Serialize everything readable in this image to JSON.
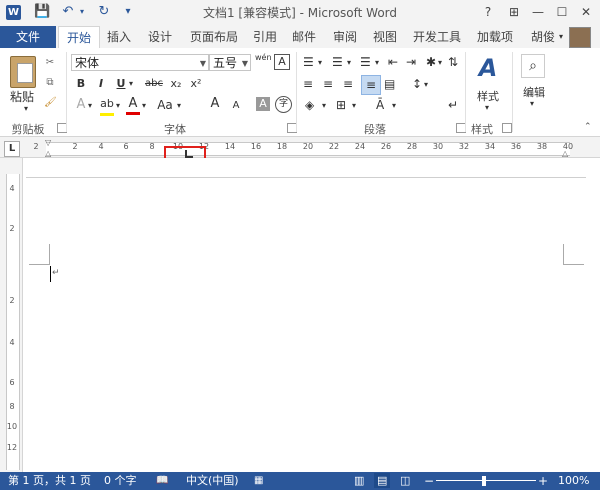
{
  "window": {
    "title": "文档1 [兼容模式] - Microsoft Word",
    "logo": "W",
    "controls": [
      "?",
      "⊞",
      "—",
      "☐",
      "✕"
    ]
  },
  "qat": [
    "save-icon",
    "undo-icon",
    "redo-icon",
    "customize-icon"
  ],
  "tabs": {
    "file": "文件",
    "items": [
      "开始",
      "插入",
      "设计",
      "页面布局",
      "引用",
      "邮件",
      "审阅",
      "视图",
      "开发工具",
      "加载项"
    ],
    "user": "胡俊"
  },
  "ribbon": {
    "clipboard": {
      "paste": "粘贴",
      "label": "剪贴板"
    },
    "font": {
      "font_name": "宋体",
      "font_size": "五号",
      "wen": "wén",
      "buttons": [
        "B",
        "I",
        "U",
        "abc",
        "x₂",
        "x²",
        "Aa",
        "A",
        "A"
      ],
      "grow": "A",
      "shrink": "A",
      "label": "字体"
    },
    "paragraph": {
      "label": "段落"
    },
    "styles": {
      "button": "样式",
      "label": "样式"
    },
    "editing": {
      "button": "编辑"
    }
  },
  "ruler": {
    "numbers": [
      "2",
      "2",
      "4",
      "6",
      "8",
      "10",
      "12",
      "14",
      "16",
      "18",
      "20",
      "22",
      "24",
      "26",
      "28",
      "30",
      "32",
      "34",
      "36",
      "38",
      "40"
    ],
    "tab_marker": "L"
  },
  "vruler": {
    "numbers": [
      "4",
      "2",
      "2",
      "4",
      "6",
      "8",
      "10",
      "12"
    ]
  },
  "status": {
    "page": "第 1 页，共 1 页",
    "words": "0 个字",
    "language": "中文(中国)",
    "zoom": "100%"
  },
  "colors": {
    "accent": "#2b579a",
    "highlight_box": "#e0201b"
  }
}
